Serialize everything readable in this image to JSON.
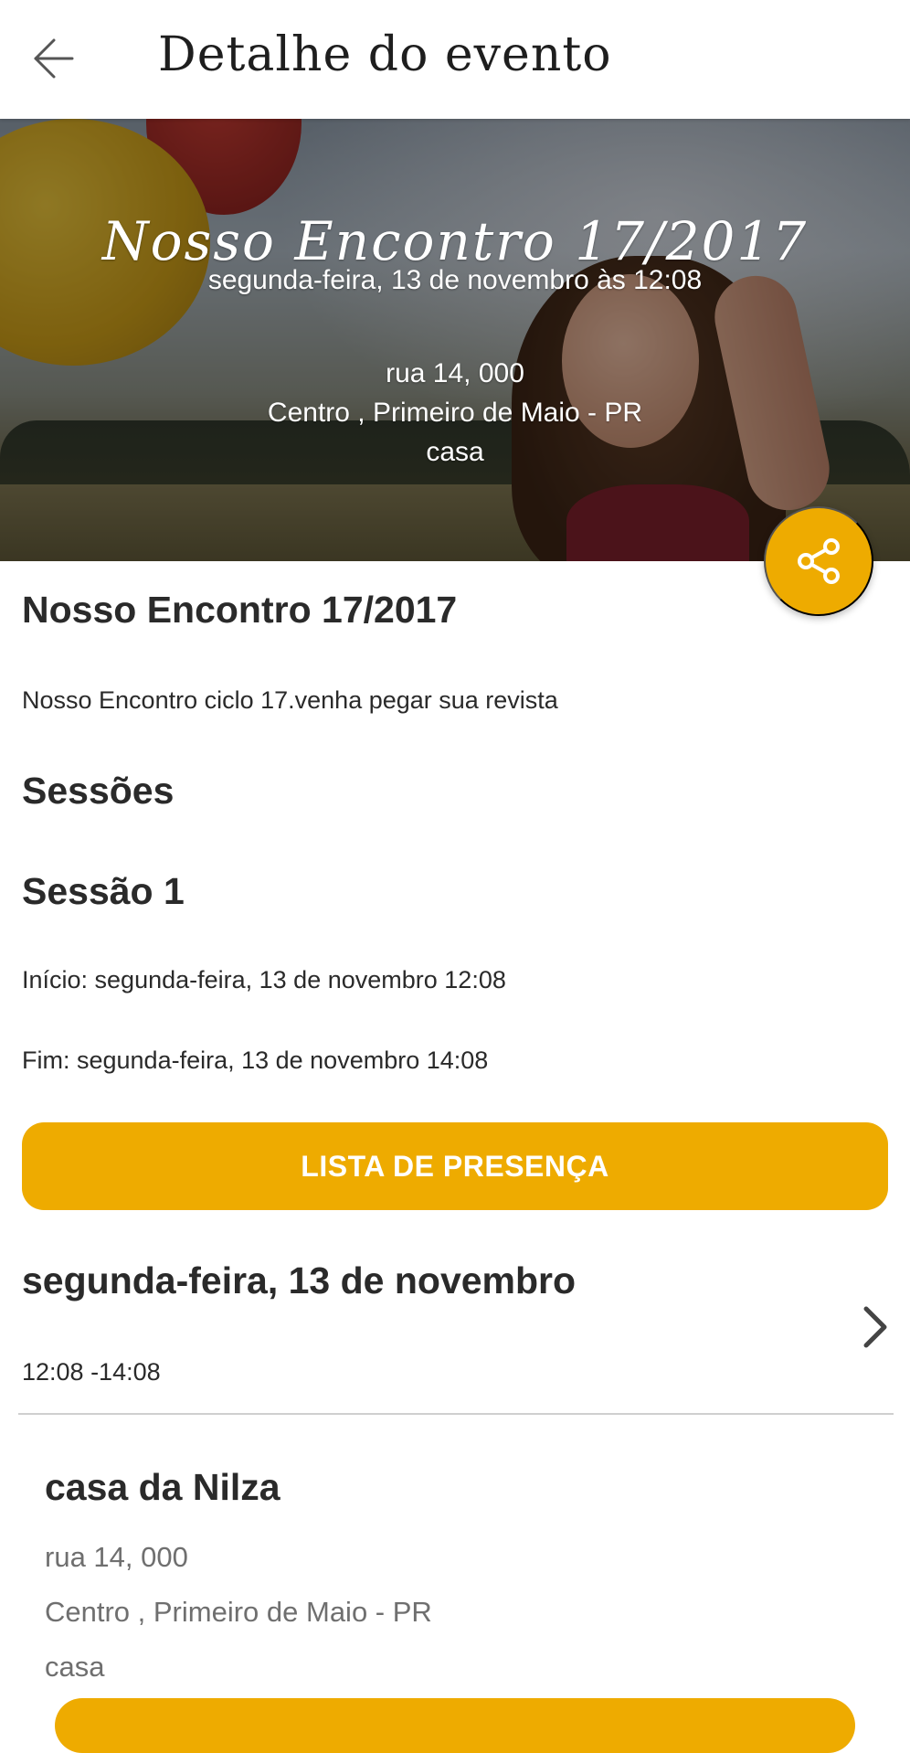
{
  "app_bar": {
    "title": "Detalhe do evento",
    "back_icon": "arrow-left-icon"
  },
  "hero": {
    "title": "Nosso Encontro 17/2017",
    "date": "segunda-feira, 13 de novembro às 12:08",
    "address_line1": "rua 14, 000",
    "address_line2": "Centro , Primeiro de Maio - PR",
    "address_line3": "casa"
  },
  "share_button": {
    "icon": "share-icon",
    "color": "#eeab00"
  },
  "event": {
    "title": "Nosso Encontro 17/2017",
    "description": "Nosso Encontro ciclo 17.venha pegar sua revista"
  },
  "sessions": {
    "heading": "Sessões",
    "items": [
      {
        "name": "Sessão 1",
        "start": "Início: segunda-feira, 13 de novembro 12:08",
        "end": "Fim: segunda-feira, 13 de novembro 14:08",
        "button_label": "LISTA DE PRESENÇA"
      }
    ]
  },
  "schedule": {
    "date": "segunda-feira, 13 de novembro",
    "time": "12:08 -14:08",
    "chevron_icon": "chevron-right-icon"
  },
  "venue": {
    "name": "casa da Nilza",
    "line1": "rua 14, 000",
    "line2": "Centro , Primeiro de Maio - PR",
    "line3": "casa"
  },
  "colors": {
    "accent": "#eeab00",
    "text_primary": "#2a2a2a",
    "text_secondary": "#6f6f6f"
  }
}
